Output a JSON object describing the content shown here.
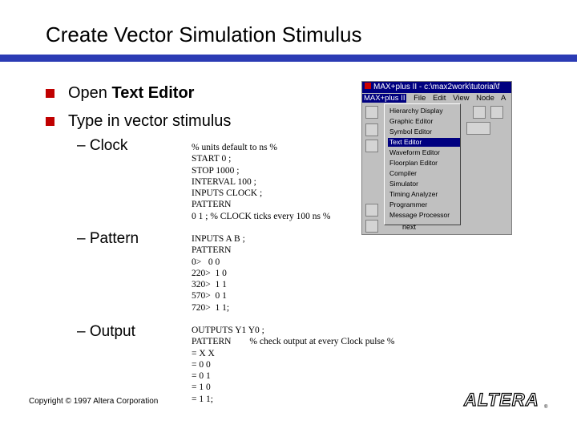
{
  "slide": {
    "title": "Create Vector Simulation Stimulus",
    "bullets": [
      {
        "prefix": "Open ",
        "bold": "Text Editor"
      },
      {
        "text": "Type in vector stimulus"
      }
    ],
    "subitems": [
      {
        "label": "– Clock",
        "code": "% units default to ns %\nSTART 0 ;\nSTOP 1000 ;\nINTERVAL 100 ;\nINPUTS CLOCK ;\nPATTERN\n0 1 ; % CLOCK ticks every 100 ns %"
      },
      {
        "label": "– Pattern",
        "code": "INPUTS A B ;\nPATTERN\n0>   0 0\n220>  1 0\n320>  1 1\n570>  0 1\n720>  1 1;"
      },
      {
        "label": "– Output",
        "code": "OUTPUTS Y1 Y0 ;\nPATTERN        % check output at every Clock pulse %\n= X X\n= 0 0\n= 0 1\n= 1 0\n= 1 1;"
      }
    ],
    "copyright": "Copyright © 1997 Altera Corporation",
    "logo_text": "ALTERA",
    "accent_color": "#2b3bb4",
    "bullet_color": "#c00000"
  },
  "screenshot": {
    "window_title": "MAX+plus II - c:\\max2work\\tutorial\\f",
    "menus": [
      "MAX+plus II",
      "File",
      "Edit",
      "View",
      "Node",
      "A"
    ],
    "dropdown_items": [
      "Hierarchy Display",
      "Graphic Editor",
      "Symbol Editor",
      "Text Editor",
      "Waveform Editor",
      "Floorplan Editor",
      "Compiler",
      "Simulator",
      "Timing Analyzer",
      "Programmer",
      "Message Processor"
    ],
    "selected_item": "Text Editor",
    "footer_label": "next"
  }
}
